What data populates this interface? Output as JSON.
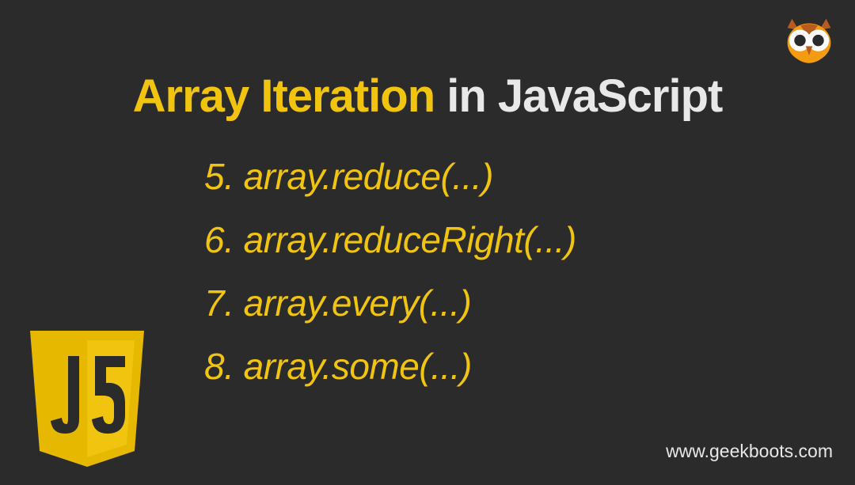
{
  "title": {
    "highlight": "Array Iteration",
    "connector": " in ",
    "subject": "JavaScript"
  },
  "list": {
    "items": [
      {
        "number": "5.",
        "text": "array.reduce(...)"
      },
      {
        "number": "6.",
        "text": "array.reduceRight(...)"
      },
      {
        "number": "7.",
        "text": "array.every(...)"
      },
      {
        "number": "8.",
        "text": "array.some(...)"
      }
    ]
  },
  "footer": {
    "url": "www.geekboots.com"
  },
  "logos": {
    "owl": "owl-icon",
    "js": "javascript-shield-icon"
  }
}
